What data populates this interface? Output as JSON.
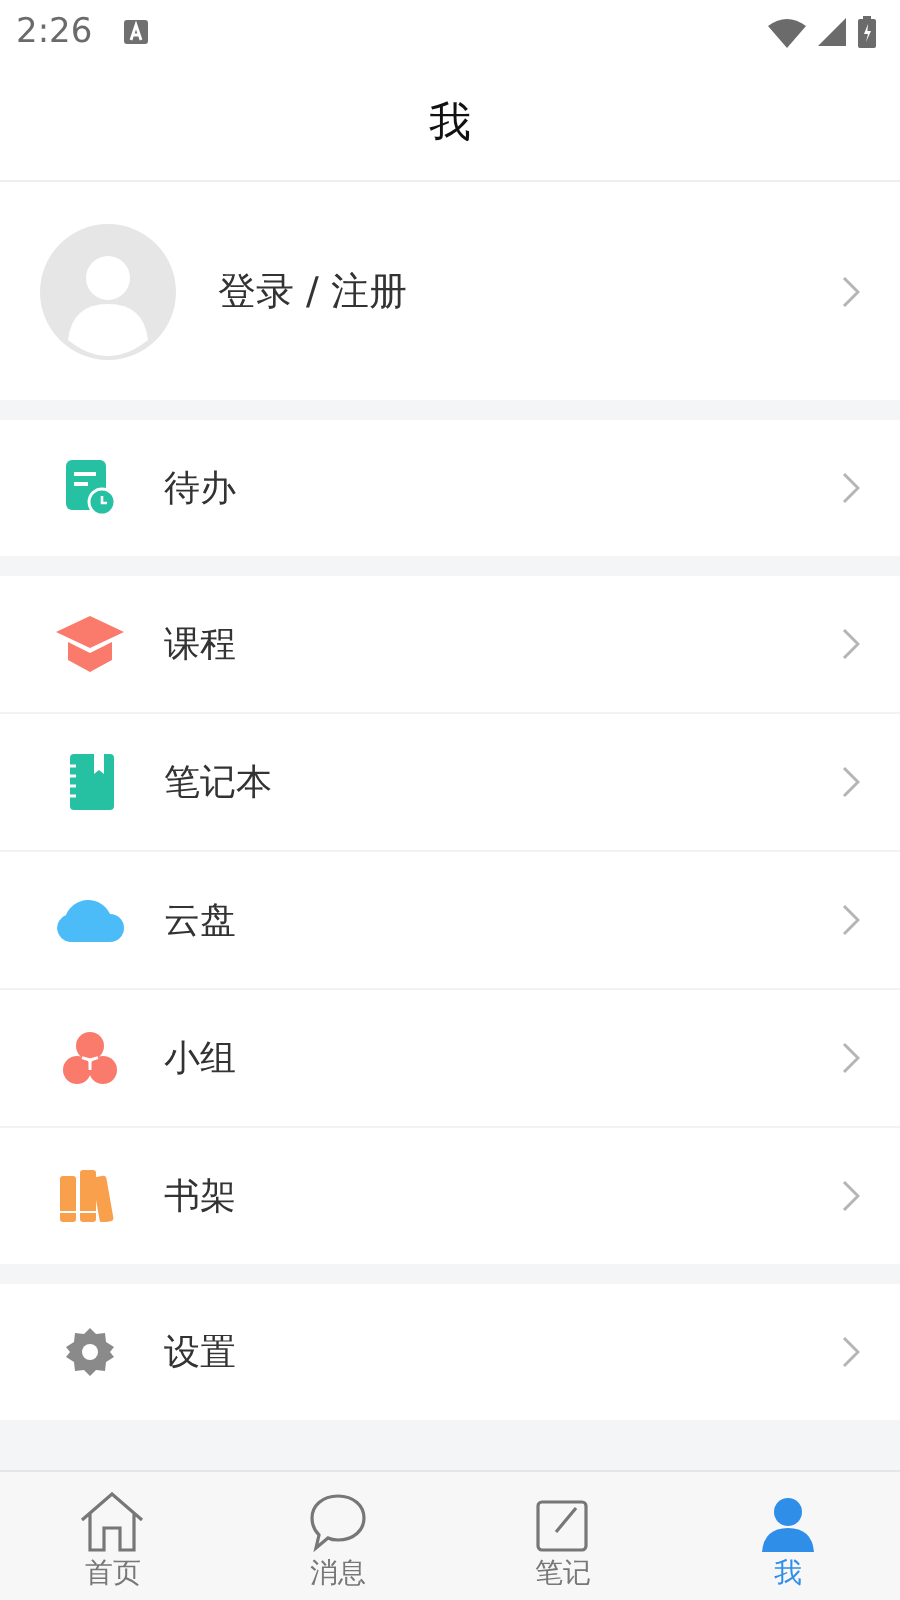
{
  "status_bar": {
    "time": "2:26"
  },
  "header": {
    "title": "我"
  },
  "profile": {
    "label": "登录 / 注册"
  },
  "sections": [
    [
      {
        "label": "待办"
      }
    ],
    [
      {
        "label": "课程"
      },
      {
        "label": "笔记本"
      },
      {
        "label": "云盘"
      },
      {
        "label": "小组"
      },
      {
        "label": "书架"
      }
    ],
    [
      {
        "label": "设置"
      }
    ]
  ],
  "tabs": [
    {
      "label": "首页",
      "selected": false
    },
    {
      "label": "消息",
      "selected": false
    },
    {
      "label": "笔记",
      "selected": false
    },
    {
      "label": "我",
      "selected": true
    }
  ]
}
